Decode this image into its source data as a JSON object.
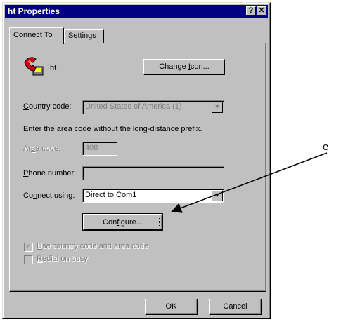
{
  "window": {
    "title": "ht Properties",
    "help_button": "?",
    "close_button": "✕"
  },
  "tabs": [
    {
      "label": "Connect To",
      "active": true
    },
    {
      "label": "Settings",
      "active": false
    }
  ],
  "connection": {
    "name": "ht",
    "icon": "phone-icon",
    "change_icon_label_pre": "Change ",
    "change_icon_label_u": "I",
    "change_icon_label_post": "con..."
  },
  "country_code": {
    "label_u": "C",
    "label_rest": "ountry code:",
    "value": "United States of America (1)"
  },
  "instruction": "Enter the area code without the long-distance prefix.",
  "area_code": {
    "label_pre": "Ar",
    "label_u": "e",
    "label_post": "a code:",
    "value": "408"
  },
  "phone_number": {
    "label_u": "P",
    "label_rest": "hone number:",
    "value": ""
  },
  "connect_using": {
    "label_pre": "Co",
    "label_u": "n",
    "label_post": "nect using:",
    "value": "Direct to Com1"
  },
  "configure": {
    "label_pre": "Con",
    "label_u": "f",
    "label_post": "igure..."
  },
  "checkboxes": [
    {
      "u": "U",
      "rest": "se country code and area code",
      "checked": true
    },
    {
      "u": "R",
      "rest": "edial on busy",
      "checked": false
    }
  ],
  "footer": {
    "ok": "OK",
    "cancel": "Cancel"
  },
  "annotation": {
    "letter": "e"
  },
  "colors": {
    "titlebar": "#000080",
    "face": "#c0c0c0",
    "disabled_text": "#808080"
  }
}
